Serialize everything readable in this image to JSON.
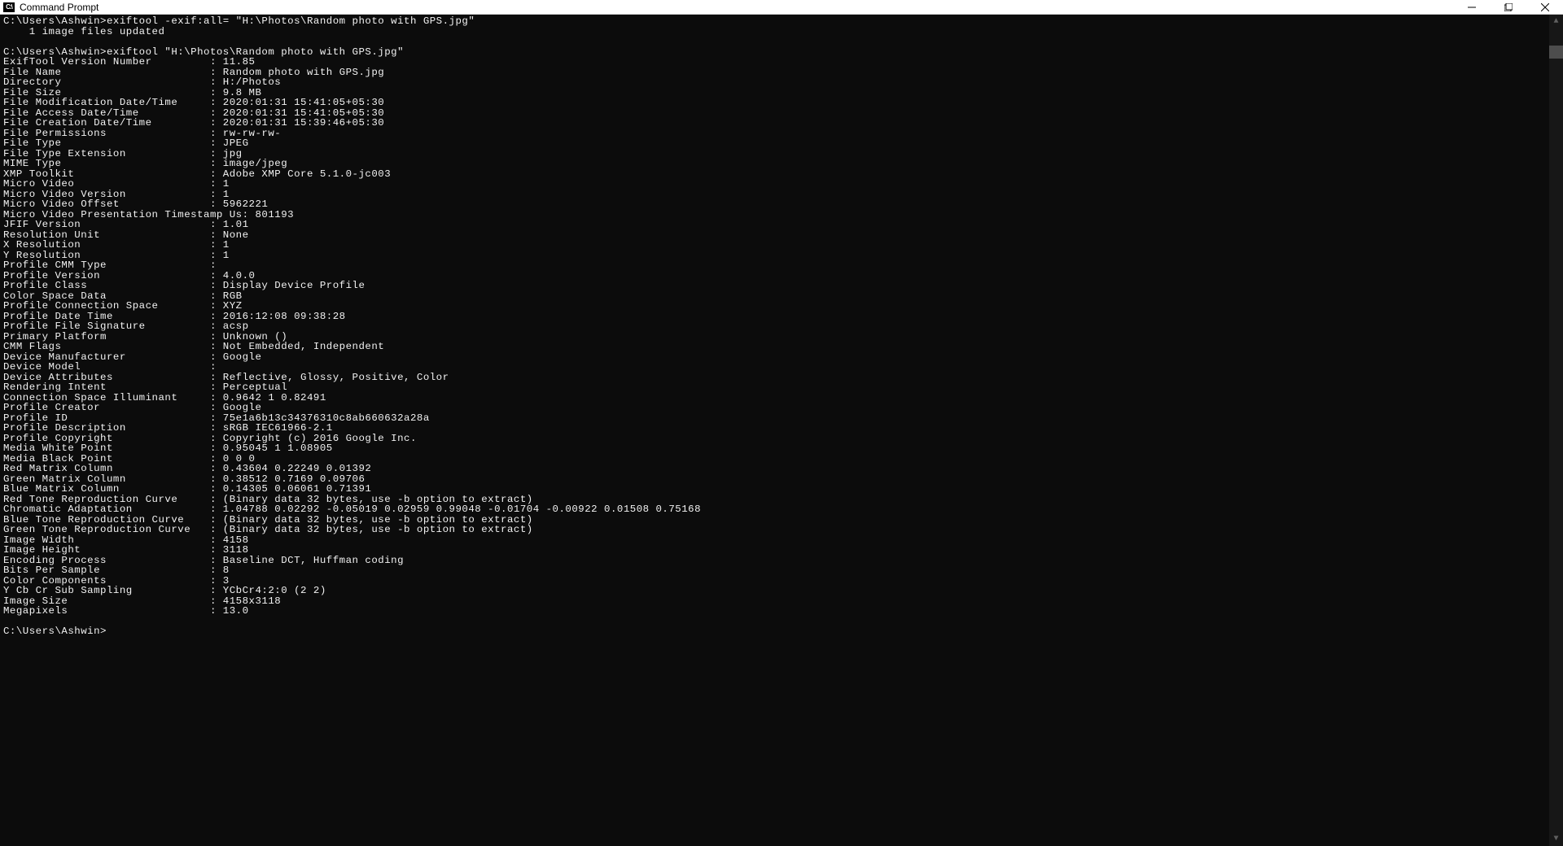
{
  "window": {
    "title": "Command Prompt"
  },
  "terminal": {
    "prompt1": "C:\\Users\\Ashwin>",
    "cmd1": "exiftool -exif:all= \"H:\\Photos\\Random photo with GPS.jpg\"",
    "result1": "    1 image files updated",
    "blank1": "",
    "prompt2": "C:\\Users\\Ashwin>",
    "cmd2": "exiftool \"H:\\Photos\\Random photo with GPS.jpg\"",
    "fields": [
      {
        "k": "ExifTool Version Number",
        "v": "11.85"
      },
      {
        "k": "File Name",
        "v": "Random photo with GPS.jpg"
      },
      {
        "k": "Directory",
        "v": "H:/Photos"
      },
      {
        "k": "File Size",
        "v": "9.8 MB"
      },
      {
        "k": "File Modification Date/Time",
        "v": "2020:01:31 15:41:05+05:30"
      },
      {
        "k": "File Access Date/Time",
        "v": "2020:01:31 15:41:05+05:30"
      },
      {
        "k": "File Creation Date/Time",
        "v": "2020:01:31 15:39:46+05:30"
      },
      {
        "k": "File Permissions",
        "v": "rw-rw-rw-"
      },
      {
        "k": "File Type",
        "v": "JPEG"
      },
      {
        "k": "File Type Extension",
        "v": "jpg"
      },
      {
        "k": "MIME Type",
        "v": "image/jpeg"
      },
      {
        "k": "XMP Toolkit",
        "v": "Adobe XMP Core 5.1.0-jc003"
      },
      {
        "k": "Micro Video",
        "v": "1"
      },
      {
        "k": "Micro Video Version",
        "v": "1"
      },
      {
        "k": "Micro Video Offset",
        "v": "5962221"
      },
      {
        "k": "Micro Video Presentation Timestamp Us",
        "v": "801193",
        "raw": true
      },
      {
        "k": "JFIF Version",
        "v": "1.01"
      },
      {
        "k": "Resolution Unit",
        "v": "None"
      },
      {
        "k": "X Resolution",
        "v": "1"
      },
      {
        "k": "Y Resolution",
        "v": "1"
      },
      {
        "k": "Profile CMM Type",
        "v": ""
      },
      {
        "k": "Profile Version",
        "v": "4.0.0"
      },
      {
        "k": "Profile Class",
        "v": "Display Device Profile"
      },
      {
        "k": "Color Space Data",
        "v": "RGB"
      },
      {
        "k": "Profile Connection Space",
        "v": "XYZ"
      },
      {
        "k": "Profile Date Time",
        "v": "2016:12:08 09:38:28"
      },
      {
        "k": "Profile File Signature",
        "v": "acsp"
      },
      {
        "k": "Primary Platform",
        "v": "Unknown ()"
      },
      {
        "k": "CMM Flags",
        "v": "Not Embedded, Independent"
      },
      {
        "k": "Device Manufacturer",
        "v": "Google"
      },
      {
        "k": "Device Model",
        "v": ""
      },
      {
        "k": "Device Attributes",
        "v": "Reflective, Glossy, Positive, Color"
      },
      {
        "k": "Rendering Intent",
        "v": "Perceptual"
      },
      {
        "k": "Connection Space Illuminant",
        "v": "0.9642 1 0.82491"
      },
      {
        "k": "Profile Creator",
        "v": "Google"
      },
      {
        "k": "Profile ID",
        "v": "75e1a6b13c34376310c8ab660632a28a"
      },
      {
        "k": "Profile Description",
        "v": "sRGB IEC61966-2.1"
      },
      {
        "k": "Profile Copyright",
        "v": "Copyright (c) 2016 Google Inc."
      },
      {
        "k": "Media White Point",
        "v": "0.95045 1 1.08905"
      },
      {
        "k": "Media Black Point",
        "v": "0 0 0"
      },
      {
        "k": "Red Matrix Column",
        "v": "0.43604 0.22249 0.01392"
      },
      {
        "k": "Green Matrix Column",
        "v": "0.38512 0.7169 0.09706"
      },
      {
        "k": "Blue Matrix Column",
        "v": "0.14305 0.06061 0.71391"
      },
      {
        "k": "Red Tone Reproduction Curve",
        "v": "(Binary data 32 bytes, use -b option to extract)"
      },
      {
        "k": "Chromatic Adaptation",
        "v": "1.04788 0.02292 -0.05019 0.02959 0.99048 -0.01704 -0.00922 0.01508 0.75168"
      },
      {
        "k": "Blue Tone Reproduction Curve",
        "v": "(Binary data 32 bytes, use -b option to extract)"
      },
      {
        "k": "Green Tone Reproduction Curve",
        "v": "(Binary data 32 bytes, use -b option to extract)"
      },
      {
        "k": "Image Width",
        "v": "4158"
      },
      {
        "k": "Image Height",
        "v": "3118"
      },
      {
        "k": "Encoding Process",
        "v": "Baseline DCT, Huffman coding"
      },
      {
        "k": "Bits Per Sample",
        "v": "8"
      },
      {
        "k": "Color Components",
        "v": "3"
      },
      {
        "k": "Y Cb Cr Sub Sampling",
        "v": "YCbCr4:2:0 (2 2)"
      },
      {
        "k": "Image Size",
        "v": "4158x3118"
      },
      {
        "k": "Megapixels",
        "v": "13.0"
      }
    ],
    "blank2": "",
    "prompt3": "C:\\Users\\Ashwin>"
  }
}
